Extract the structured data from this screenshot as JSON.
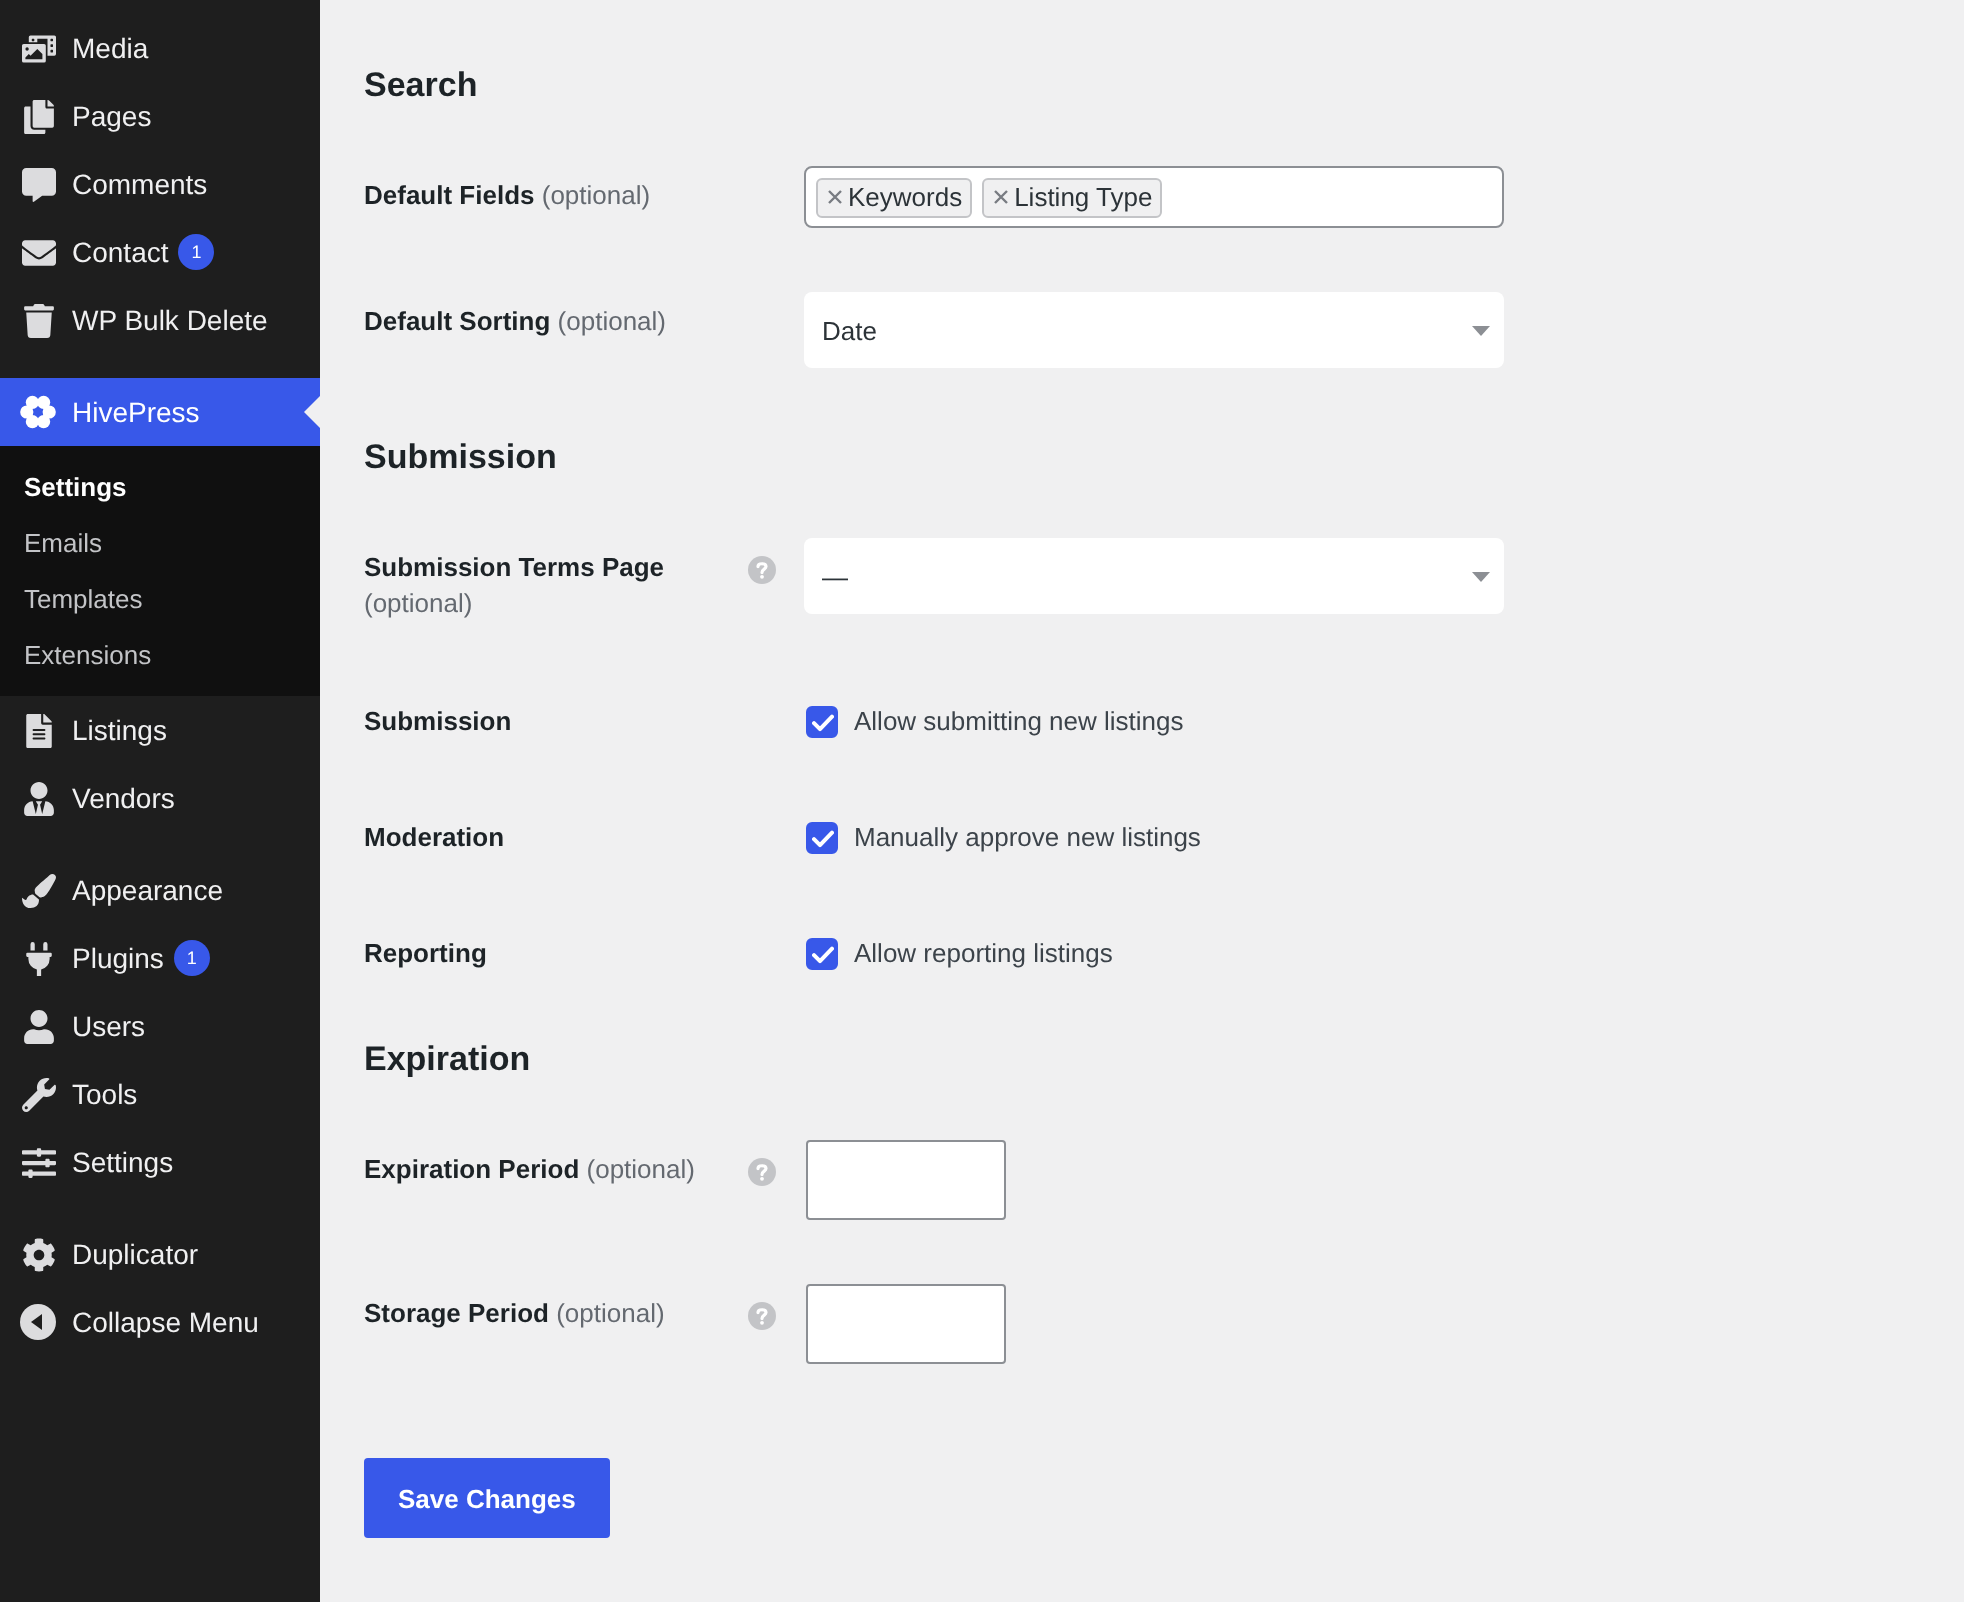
{
  "sidebar": {
    "groups": [
      {
        "items": [
          {
            "label": "Media",
            "selected": false
          },
          {
            "label": "Pages",
            "selected": false
          },
          {
            "label": "Comments",
            "selected": false
          },
          {
            "label": "Contact",
            "badge": "1",
            "selected": false
          },
          {
            "label": "WP Bulk Delete",
            "selected": false
          }
        ]
      },
      {
        "items": [
          {
            "label": "HivePress",
            "selected": true,
            "children": [
              {
                "label": "Settings",
                "selected": true
              },
              {
                "label": "Emails",
                "selected": false
              },
              {
                "label": "Templates",
                "selected": false
              },
              {
                "label": "Extensions",
                "selected": false
              }
            ]
          },
          {
            "label": "Listings",
            "selected": false
          },
          {
            "label": "Vendors",
            "selected": false
          }
        ]
      },
      {
        "items": [
          {
            "label": "Appearance",
            "selected": false
          },
          {
            "label": "Plugins",
            "badge": "1",
            "selected": false
          },
          {
            "label": "Users",
            "selected": false
          },
          {
            "label": "Tools",
            "selected": false
          },
          {
            "label": "Settings",
            "selected": false
          }
        ]
      },
      {
        "items": [
          {
            "label": "Duplicator",
            "selected": false
          }
        ]
      }
    ],
    "collapse_button": {
      "label": "Collapse Menu"
    }
  },
  "sections": [
    {
      "title": "Search",
      "fields": [
        {
          "kind": "tags",
          "label": "Default Fields",
          "note": "(optional)",
          "help": false,
          "tags": [
            "Keywords",
            "Listing Type"
          ]
        },
        {
          "kind": "select",
          "label": "Default Sorting",
          "note": "(optional)",
          "help": false,
          "value": "Date"
        }
      ]
    },
    {
      "title": "Submission",
      "fields": [
        {
          "kind": "select",
          "label": "Submission Terms Page",
          "note": "(optional)",
          "help": true,
          "value": "—"
        },
        {
          "kind": "checkbox",
          "label": "Submission",
          "help": false,
          "text": "Allow submitting new listings",
          "checked": true
        },
        {
          "kind": "checkbox",
          "label": "Moderation",
          "help": false,
          "text": "Manually approve new listings",
          "checked": true
        },
        {
          "kind": "checkbox",
          "label": "Reporting",
          "help": false,
          "text": "Allow reporting listings",
          "checked": true
        }
      ]
    },
    {
      "title": "Expiration",
      "fields": [
        {
          "kind": "text",
          "label": "Expiration Period",
          "note": "(optional)",
          "help": true
        },
        {
          "kind": "text",
          "label": "Storage Period",
          "note": "(optional)",
          "help": true
        }
      ]
    }
  ],
  "save_button": {
    "label": "Save Changes"
  }
}
